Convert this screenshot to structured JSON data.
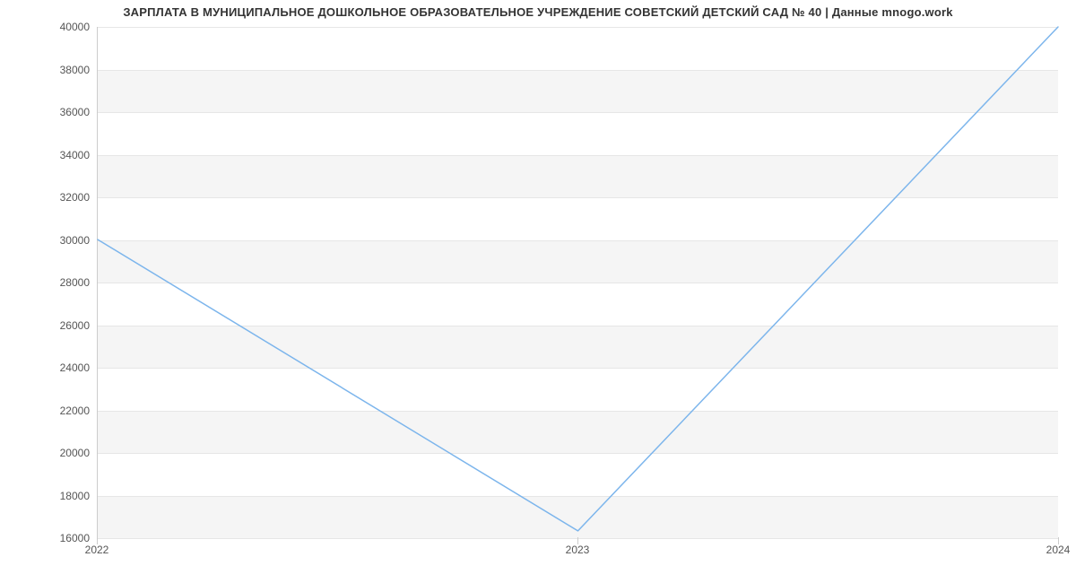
{
  "chart_data": {
    "type": "line",
    "title": "ЗАРПЛАТА В МУНИЦИПАЛЬНОЕ ДОШКОЛЬНОЕ ОБРАЗОВАТЕЛЬНОЕ УЧРЕЖДЕНИЕ СОВЕТСКИЙ ДЕТСКИЙ САД № 40 | Данные mnogo.work",
    "xlabel": "",
    "ylabel": "",
    "x_ticks": [
      "2022",
      "2023",
      "2024"
    ],
    "y_ticks": [
      16000,
      18000,
      20000,
      22000,
      24000,
      26000,
      28000,
      30000,
      32000,
      34000,
      36000,
      38000,
      40000
    ],
    "ylim": [
      16000,
      40000
    ],
    "x": [
      2022,
      2023,
      2024
    ],
    "values": [
      30000,
      16300,
      40000
    ],
    "line_color": "#7cb5ec"
  }
}
